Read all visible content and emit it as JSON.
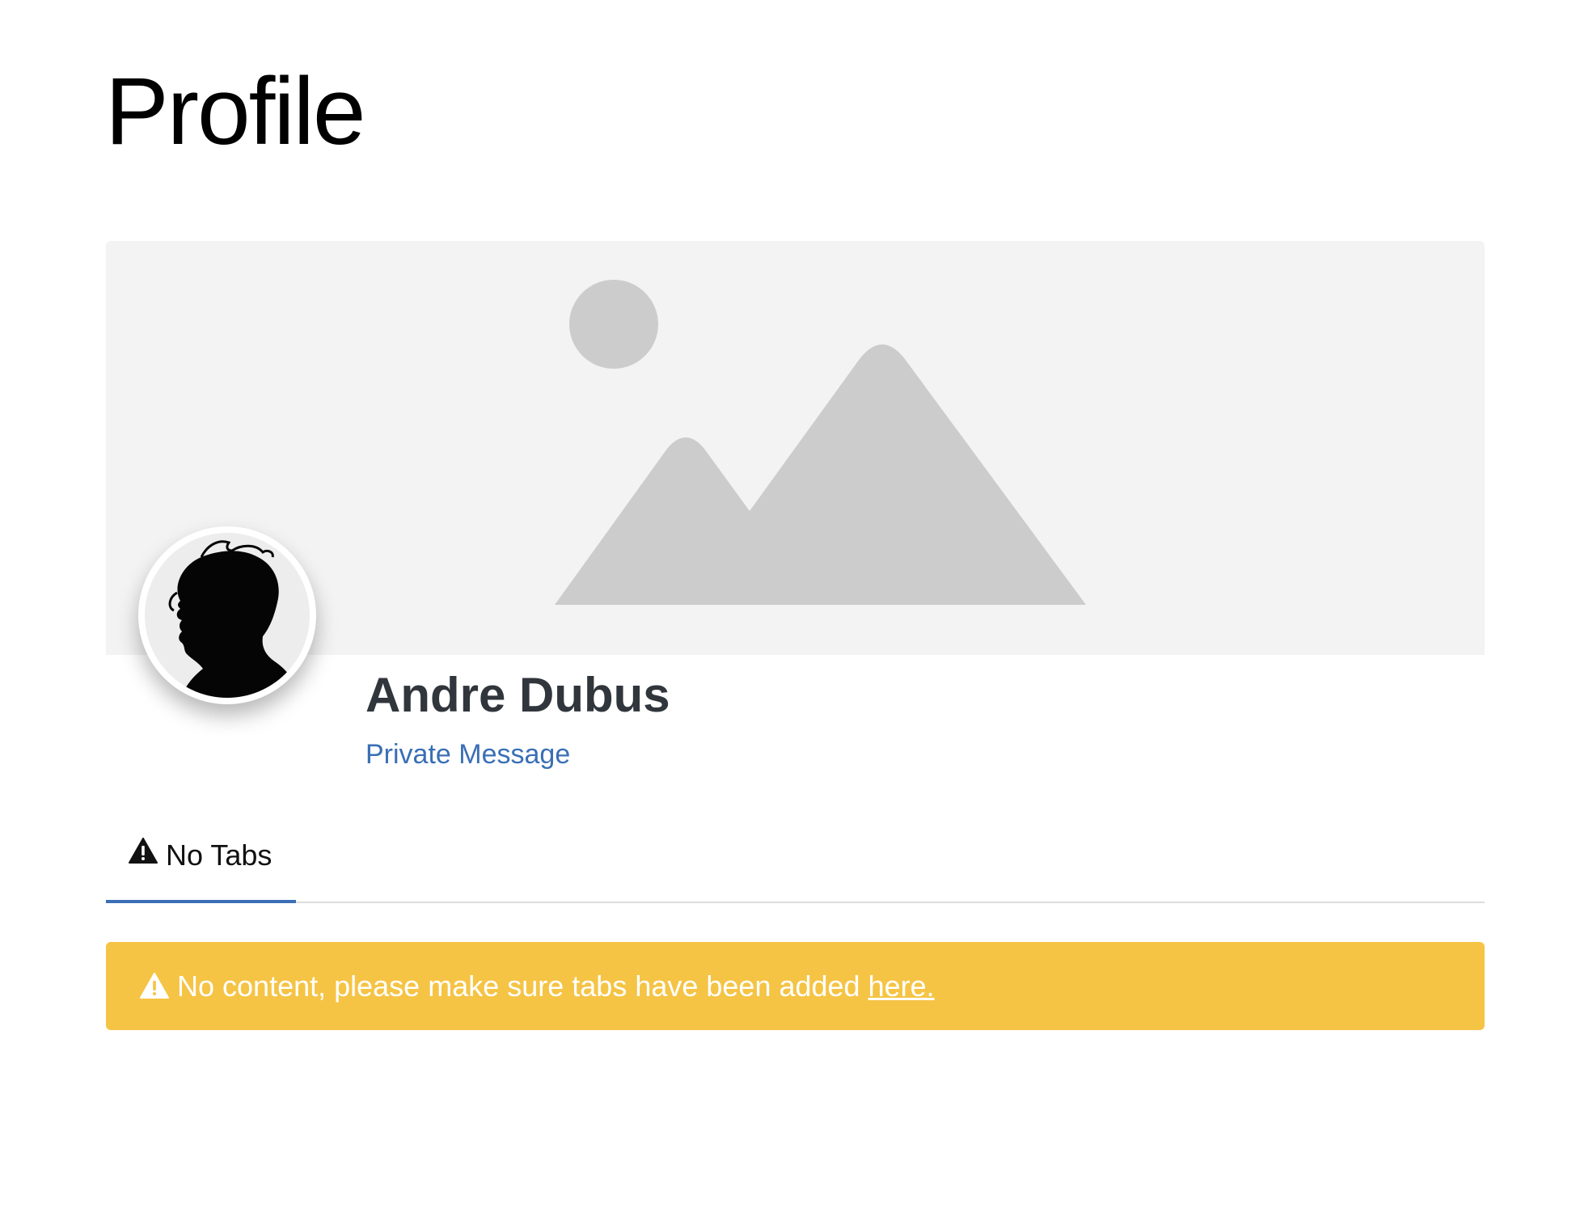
{
  "page": {
    "title": "Profile"
  },
  "profile": {
    "name": "Andre Dubus",
    "private_message_label": "Private Message"
  },
  "tabs": [
    {
      "label": "No Tabs",
      "icon": "warning-icon",
      "active": true
    }
  ],
  "alert": {
    "icon": "warning-icon",
    "text": "No content, please make sure tabs have been added",
    "link_label": "here."
  },
  "colors": {
    "link": "#3a6fb5",
    "alert_background": "#f5c445",
    "cover_background": "#f3f3f3",
    "cover_shapes": "#cccccc",
    "name_text": "#31363c"
  }
}
